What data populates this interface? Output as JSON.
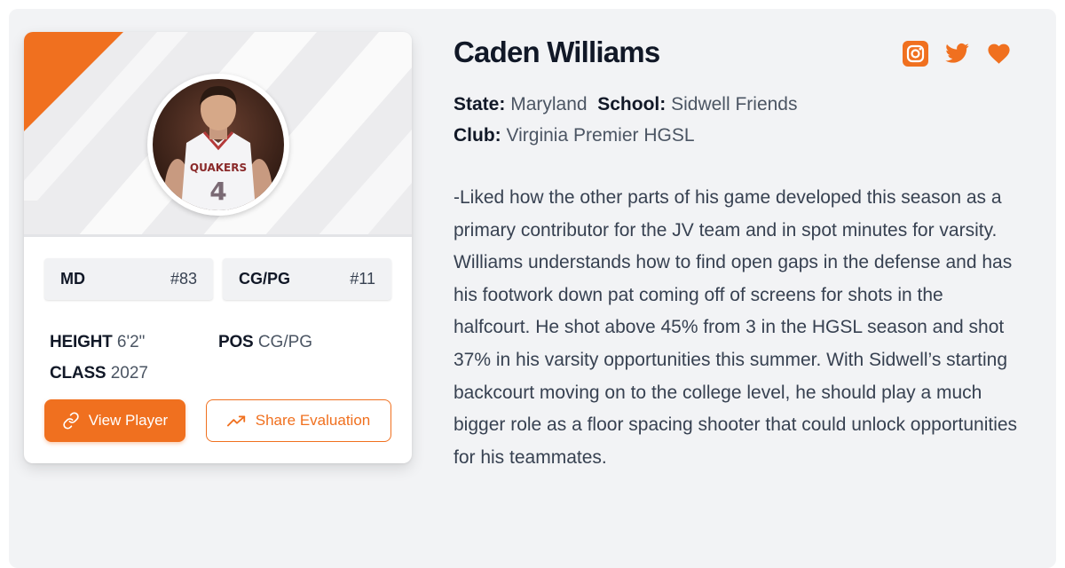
{
  "player": {
    "name": "Caden Williams",
    "state_label": "State:",
    "state": "Maryland",
    "school_label": "School:",
    "school": "Sidwell Friends",
    "club_label": "Club:",
    "club": "Virginia Premier HGSL",
    "evaluation": "-Liked how the other parts of his game developed this season as a primary contributor for the JV team and in spot minutes for varsity. Williams understands how to find open gaps in the defense and has his footwork down pat coming off of screens for shots in the halfcourt. He shot above 45% from 3 in the HGSL season and shot 37% in his varsity opportunities this summer. With Sidwell’s starting backcourt moving on to the college level, he should play a much bigger role as a floor spacing shooter that could unlock opportunities for his teammates."
  },
  "card": {
    "jersey_text": "QUAKERS",
    "jersey_number": "4",
    "state_rank": {
      "code": "MD",
      "rank": "#83"
    },
    "position_rank": {
      "code": "CG/PG",
      "rank": "#11"
    },
    "stats": {
      "height_label": "HEIGHT",
      "height": "6'2\"",
      "pos_label": "POS",
      "pos": "CG/PG",
      "class_label": "CLASS",
      "class": "2027"
    },
    "buttons": {
      "view_player": "View Player",
      "share_evaluation": "Share Evaluation"
    }
  },
  "socials": [
    "instagram-icon",
    "twitter-icon",
    "heart-icon"
  ],
  "colors": {
    "accent": "#f0701f",
    "panel_bg": "#f2f3f5",
    "text_dark": "#111827",
    "text_body": "#374151"
  }
}
